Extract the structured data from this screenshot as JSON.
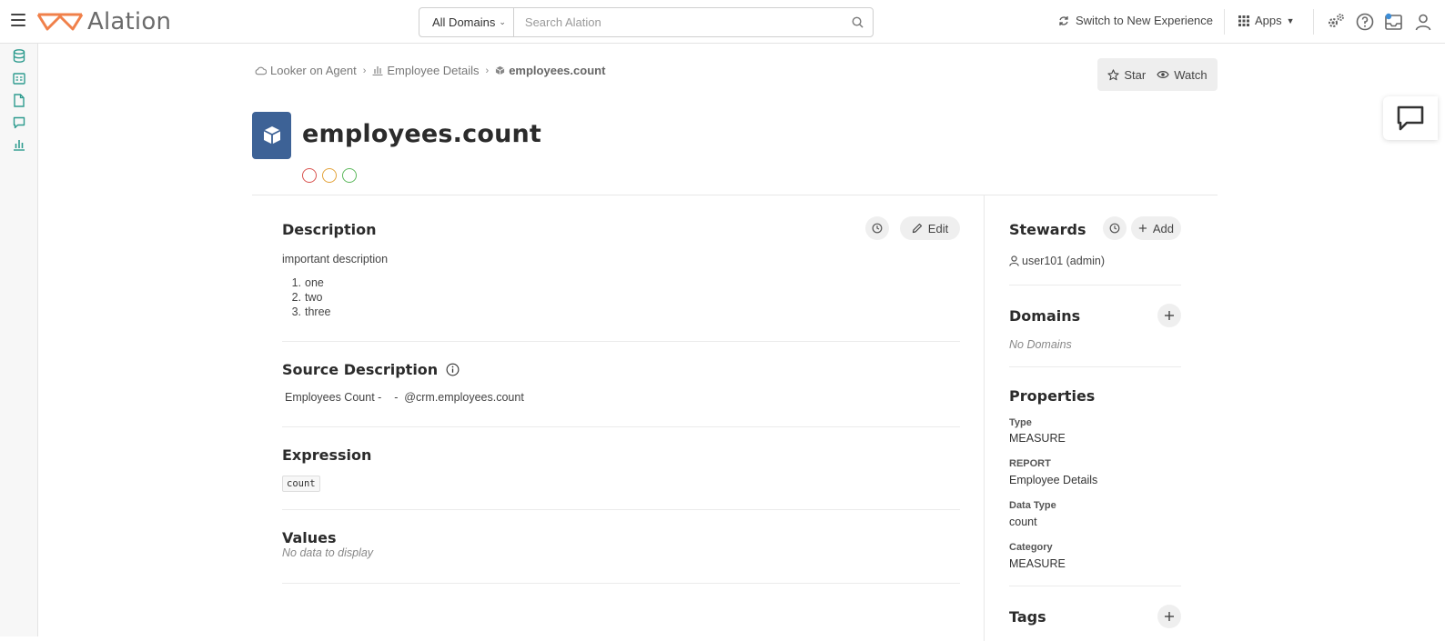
{
  "topbar": {
    "logo_text": "Alation",
    "domain_select": "All Domains",
    "search_placeholder": "Search Alation",
    "switch_experience": "Switch to New Experience",
    "apps_label": "Apps"
  },
  "breadcrumb": [
    {
      "label": "Looker on Agent"
    },
    {
      "label": "Employee Details"
    },
    {
      "label": "employees.count"
    }
  ],
  "actions": {
    "star": "Star",
    "watch": "Watch"
  },
  "object": {
    "title": "employees.count"
  },
  "flags": [
    {
      "name": "deprecation",
      "color": "#d9534f"
    },
    {
      "name": "warning",
      "color": "#e3a33a"
    },
    {
      "name": "endorsement",
      "color": "#5cb85c"
    }
  ],
  "description": {
    "title": "Description",
    "edit_label": "Edit",
    "text": "important description",
    "items": [
      "one",
      "two",
      "three"
    ],
    "numbers": [
      "1.",
      "2.",
      "3."
    ]
  },
  "source_description": {
    "title": "Source Description",
    "text": "Employees Count -    -  @crm.employees.count"
  },
  "expression": {
    "title": "Expression",
    "code": "count"
  },
  "values": {
    "title": "Values",
    "empty": "No data to display"
  },
  "stewards": {
    "title": "Stewards",
    "add_label": "Add",
    "user": "user101 (admin)"
  },
  "domains": {
    "title": "Domains",
    "empty": "No Domains"
  },
  "properties": {
    "title": "Properties",
    "items": [
      {
        "label": "Type",
        "value": "MEASURE"
      },
      {
        "label": "REPORT",
        "value": "Employee Details"
      },
      {
        "label": "Data Type",
        "value": "count"
      },
      {
        "label": "Category",
        "value": "MEASURE"
      }
    ]
  },
  "tags": {
    "title": "Tags"
  },
  "colors": {
    "brand_orange": "#f0804a",
    "object_blue": "#3d6296",
    "rail_teal": "#2f9c8f"
  }
}
